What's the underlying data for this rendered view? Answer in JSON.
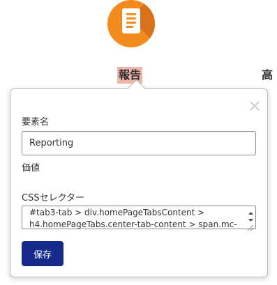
{
  "tabs": {
    "current_label": "報告",
    "next_label_partial": "高"
  },
  "icon": {
    "name": "report-document-icon",
    "color": "#f28a1d"
  },
  "popover": {
    "close_icon": "close-icon",
    "element_name_label": "要素名",
    "element_name_value": "Reporting",
    "value_label": "価値",
    "css_selector_label": "CSSセレクター",
    "css_selector_value": "#tab3-tab > div.homePageTabsContent > h4.homePageTabs.center-tab-content > span.mc-",
    "save_label": "保存"
  },
  "colors": {
    "accent": "#162a8c",
    "highlight": "#eeb5a9",
    "icon_orange": "#f28a1d"
  }
}
